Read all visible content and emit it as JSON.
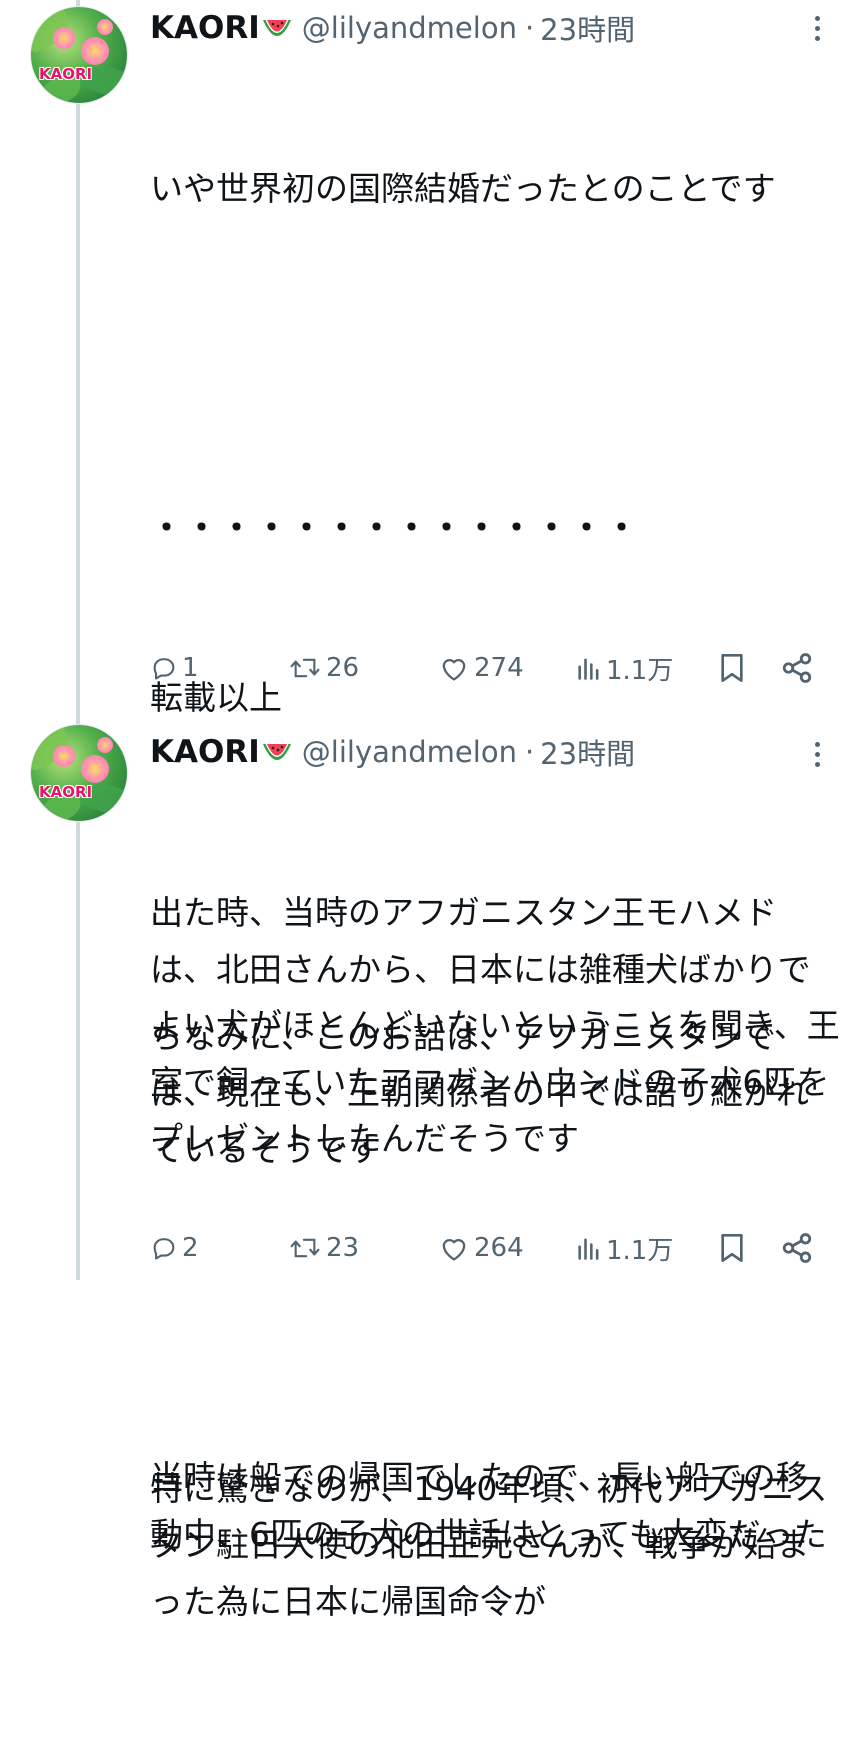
{
  "tweets": [
    {
      "author": {
        "name": "KAORI",
        "handle": "@lilyandmelon",
        "separator": "·",
        "time": "23時間",
        "avatar_logo": "KAORI"
      },
      "lines": [
        "いや世界初の国際結婚だったとのことです",
        "",
        "・・・・・・・・・・・・・・",
        "転載以上",
        "",
        "ちなみに、このお話は、アフガニスタンでは、現在も、王朝関係者の中では語り継がれているそうです",
        "",
        "特に驚きなのが、1940年頃、初代アフガニスタン駐日大使の北田正元さんが、戦争が始まった為に日本に帰国命令が"
      ],
      "stats": {
        "replies": "1",
        "retweets": "26",
        "likes": "274",
        "views": "1.1万"
      }
    },
    {
      "author": {
        "name": "KAORI",
        "handle": "@lilyandmelon",
        "separator": "·",
        "time": "23時間",
        "avatar_logo": "KAORI"
      },
      "lines": [
        "出た時、当時のアフガニスタン王モハメドは、北田さんから、日本には雑種犬ばかりでよい犬がほとんどいないということを聞き、王室で飼っていたアフガンハウンドの子犬6匹をプレゼントしたんだそうです",
        "",
        "当時は船での帰国でしたので、長い船での移動中、6匹の子犬の世話はとっても大変だった"
      ],
      "stats": {
        "replies": "2",
        "retweets": "23",
        "likes": "264",
        "views": "1.1万"
      }
    }
  ],
  "icons": {
    "reply": "speech-bubble-icon",
    "retweet": "repost-arrows-icon",
    "like": "heart-icon",
    "views": "bar-chart-icon",
    "bookmark": "bookmark-icon",
    "share": "share-icon",
    "more": "more-dots-icon",
    "emoji": "watermelon-emoji"
  },
  "colors": {
    "text": "#0f1419",
    "secondary": "#536471",
    "thread_line": "#cfd9de",
    "avatar_logo": "#e8136b"
  }
}
